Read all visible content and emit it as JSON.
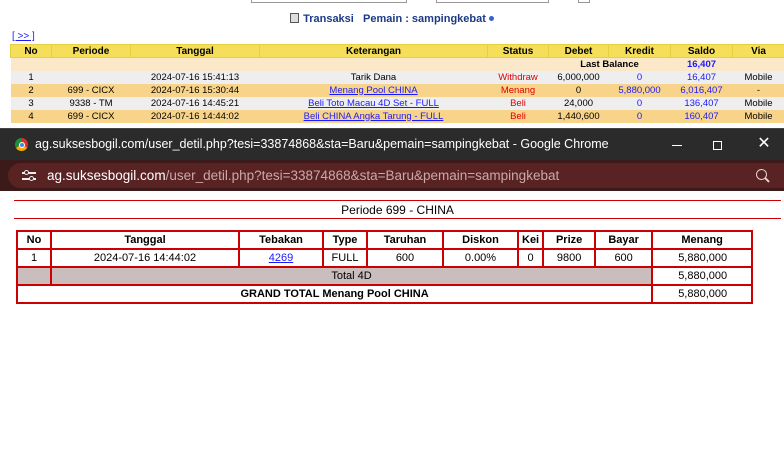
{
  "background_page": {
    "title_prefix": "Transaksi",
    "title_label": "Pemain : sampingkebat",
    "next_link": "[ >> ]",
    "columns": [
      "No",
      "Periode",
      "Tanggal",
      "Keterangan",
      "Status",
      "Debet",
      "Kredit",
      "Saldo",
      "Via"
    ],
    "last_balance_label": "Last Balance",
    "last_balance_value": "16,407",
    "rows": [
      {
        "no": "1",
        "periode": "",
        "tanggal": "2024-07-16 15:41:13",
        "keterangan": "Tarik Dana",
        "status": "Withdraw",
        "debet": "6,000,000",
        "kredit": "0",
        "saldo": "16,407",
        "via": "Mobile"
      },
      {
        "no": "2",
        "periode": "699 - CICX",
        "tanggal": "2024-07-16 15:30:44",
        "keterangan": "Menang Pool CHINA",
        "status": "Menang",
        "debet": "0",
        "kredit": "5,880,000",
        "saldo": "6,016,407",
        "via": "-"
      },
      {
        "no": "3",
        "periode": "9338 - TM",
        "tanggal": "2024-07-16 14:45:21",
        "keterangan": "Beli Toto Macau 4D Set - FULL",
        "status": "Beli",
        "debet": "24,000",
        "kredit": "0",
        "saldo": "136,407",
        "via": "Mobile"
      },
      {
        "no": "4",
        "periode": "699 - CICX",
        "tanggal": "2024-07-16 14:44:02",
        "keterangan": "Beli CHINA Angka Tarung - FULL",
        "status": "Beli",
        "debet": "1,440,600",
        "kredit": "0",
        "saldo": "160,407",
        "via": "Mobile"
      }
    ]
  },
  "popup": {
    "window_title": "ag.suksesbogil.com/user_detil.php?tesi=33874868&sta=Baru&pemain=sampingkebat - Google Chrome",
    "url_host": "ag.suksesbogil.com",
    "url_path": "/user_detil.php?tesi=33874868&sta=Baru&pemain=sampingkebat",
    "close_glyph": "✕",
    "periode_title": "Periode 699 - CHINA",
    "columns": [
      "No",
      "Tanggal",
      "Tebakan",
      "Type",
      "Taruhan",
      "Diskon",
      "Kei",
      "Prize",
      "Bayar",
      "Menang"
    ],
    "rows": [
      {
        "no": "1",
        "tanggal": "2024-07-16 14:44:02",
        "tebakan": "4269",
        "type": "FULL",
        "taruhan": "600",
        "diskon": "0.00%",
        "kei": "0",
        "prize": "9800",
        "bayar": "600",
        "menang": "5,880,000"
      }
    ],
    "total_label": "Total 4D",
    "total_value": "5,880,000",
    "grand_total_label": "GRAND TOTAL  Menang Pool CHINA",
    "grand_total_value": "5,880,000"
  },
  "colors": {
    "header_yellow": "#f5df5a",
    "title_blue": "#1b3a86",
    "link_blue": "#1a1aff",
    "status_red": "#e00000",
    "table_border_red": "#cc0000",
    "chrome_titlebar": "#2b2b2b",
    "chrome_addressbar": "#3c1a1a"
  }
}
